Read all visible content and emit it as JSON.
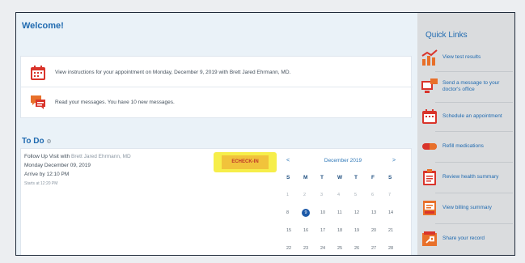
{
  "welcome": {
    "title": "Welcome!"
  },
  "messages": [
    {
      "icon": "calendar-icon",
      "text": "View instructions for your appointment on Monday, December 9, 2019 with Brett Jared Ehrmann, MD."
    },
    {
      "icon": "chat-bubble-icon",
      "text": "Read your messages. You have 10 new messages."
    }
  ],
  "todo": {
    "title": "To Do",
    "title_glyph": "⚙",
    "visit": {
      "title_prefix": "Follow Up Visit with",
      "provider": "Brett Jared Ehrmann, MD",
      "date": "Monday December 09, 2019",
      "arrive": "Arrive by 12:10 PM",
      "starts": "Starts at 12:20 PM"
    },
    "echeckin_label": "ECHECK-IN"
  },
  "calendar": {
    "prev": "<",
    "next": ">",
    "month": "December 2019",
    "weekdays": [
      "S",
      "M",
      "T",
      "W",
      "T",
      "F",
      "S"
    ],
    "weeks": [
      [
        "1",
        "2",
        "3",
        "4",
        "5",
        "6",
        "7"
      ],
      [
        "8",
        "9",
        "10",
        "11",
        "12",
        "13",
        "14"
      ],
      [
        "15",
        "16",
        "17",
        "18",
        "19",
        "20",
        "21"
      ],
      [
        "22",
        "23",
        "24",
        "25",
        "26",
        "27",
        "28"
      ]
    ],
    "selected": "9",
    "accent": "#1d5aa8"
  },
  "quick_links": {
    "title": "Quick Links",
    "items": [
      {
        "label": "View test results",
        "icon": "chart-icon"
      },
      {
        "label": "Send a message to your doctor's office",
        "icon": "message-computer-icon"
      },
      {
        "label": "Schedule an appointment",
        "icon": "calendar-icon"
      },
      {
        "label": "Refill medications",
        "icon": "pill-icon"
      },
      {
        "label": "Review health summary",
        "icon": "clipboard-icon"
      },
      {
        "label": "View billing summary",
        "icon": "billing-icon"
      },
      {
        "label": "Share your record",
        "icon": "share-icon"
      }
    ]
  },
  "colors": {
    "brand_blue": "#1f6ab0",
    "icon_orange": "#e8702a",
    "icon_red": "#d9342b",
    "highlight_yellow": "#f6ee4a"
  }
}
